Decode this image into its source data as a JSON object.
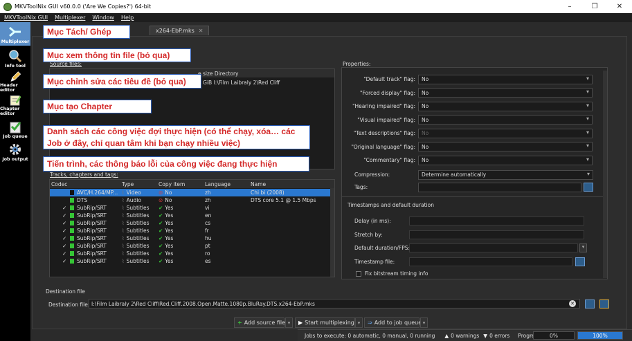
{
  "window": {
    "title": "MKVToolNix GUI v60.0.0 ('Are We Copies?') 64-bit",
    "minimize": "–",
    "maximize": "❐",
    "close": "✕"
  },
  "menu": [
    "MKVToolNix GUI",
    "Multiplexer",
    "Window",
    "Help"
  ],
  "tools": [
    {
      "label": "Multiplexer",
      "icon": "multiplexer-icon"
    },
    {
      "label": "Info tool",
      "icon": "magnifier-icon"
    },
    {
      "label": "Header editor",
      "icon": "pencil-icon"
    },
    {
      "label": "Chapter editor",
      "icon": "notepad-icon"
    },
    {
      "label": "Job queue",
      "icon": "checklist-icon"
    },
    {
      "label": "Job output",
      "icon": "gear-icon"
    }
  ],
  "tab": {
    "label": "x264-EbP.mks",
    "close": "✕"
  },
  "source_files": {
    "label": "Source files:",
    "header_tail": "e size Directory",
    "row_tail": "7 GiB  I:\\Film Laibraly 2\\Red Cliff"
  },
  "tracks": {
    "label": "Tracks, chapters and tags:",
    "columns": [
      "Codec",
      "Type",
      "Copy item",
      "Language",
      "Name"
    ],
    "rows": [
      {
        "check": "",
        "codec": "AVC/H.264/MP...",
        "type": "Video",
        "copy": "No",
        "copy_yes": false,
        "lang": "zh",
        "name": "Chi bi (2008)",
        "selected": true
      },
      {
        "check": "",
        "codec": "DTS",
        "type": "Audio",
        "copy": "No",
        "copy_yes": false,
        "lang": "zh",
        "name": "DTS core 5.1 @ 1.5 Mbps",
        "selected": false
      },
      {
        "check": "✓",
        "codec": "SubRip/SRT",
        "type": "Subtitles",
        "copy": "Yes",
        "copy_yes": true,
        "lang": "vi",
        "name": "",
        "selected": false
      },
      {
        "check": "✓",
        "codec": "SubRip/SRT",
        "type": "Subtitles",
        "copy": "Yes",
        "copy_yes": true,
        "lang": "en",
        "name": "",
        "selected": false
      },
      {
        "check": "✓",
        "codec": "SubRip/SRT",
        "type": "Subtitles",
        "copy": "Yes",
        "copy_yes": true,
        "lang": "cs",
        "name": "",
        "selected": false
      },
      {
        "check": "✓",
        "codec": "SubRip/SRT",
        "type": "Subtitles",
        "copy": "Yes",
        "copy_yes": true,
        "lang": "fr",
        "name": "",
        "selected": false
      },
      {
        "check": "✓",
        "codec": "SubRip/SRT",
        "type": "Subtitles",
        "copy": "Yes",
        "copy_yes": true,
        "lang": "hu",
        "name": "",
        "selected": false
      },
      {
        "check": "✓",
        "codec": "SubRip/SRT",
        "type": "Subtitles",
        "copy": "Yes",
        "copy_yes": true,
        "lang": "pt",
        "name": "",
        "selected": false
      },
      {
        "check": "✓",
        "codec": "SubRip/SRT",
        "type": "Subtitles",
        "copy": "Yes",
        "copy_yes": true,
        "lang": "ro",
        "name": "",
        "selected": false
      },
      {
        "check": "✓",
        "codec": "SubRip/SRT",
        "type": "Subtitles",
        "copy": "Yes",
        "copy_yes": true,
        "lang": "es",
        "name": "",
        "selected": false
      }
    ]
  },
  "properties": {
    "label": "Properties:",
    "flags": [
      {
        "label": "\"Default track\" flag:",
        "value": "No",
        "disabled": false
      },
      {
        "label": "\"Forced display\" flag:",
        "value": "No",
        "disabled": false
      },
      {
        "label": "\"Hearing impaired\" flag:",
        "value": "No",
        "disabled": false
      },
      {
        "label": "\"Visual impaired\" flag:",
        "value": "No",
        "disabled": false
      },
      {
        "label": "\"Text descriptions\" flag:",
        "value": "No",
        "disabled": true
      },
      {
        "label": "\"Original language\" flag:",
        "value": "No",
        "disabled": false
      },
      {
        "label": "\"Commentary\" flag:",
        "value": "No",
        "disabled": false
      }
    ],
    "compression_label": "Compression:",
    "compression_value": "Determine automatically",
    "tags_label": "Tags:",
    "timestamps_label": "Timestamps and default duration",
    "delay_label": "Delay (in ms):",
    "stretch_label": "Stretch by:",
    "default_duration_label": "Default duration/FPS:",
    "timestamp_file_label": "Timestamp file:",
    "fix_bitstream_label": "Fix bitstream timing info"
  },
  "destination": {
    "group_label": "Destination file",
    "label": "Destination file:",
    "value": "I:\\Film Laibraly 2\\Red Cliff\\Red.Cliff.2008.Open.Matte.1080p.BluRay.DTS.x264-EbP.mks"
  },
  "actions": {
    "add_source": "Add source files",
    "start": "Start multiplexing",
    "add_queue": "Add to job queue"
  },
  "status": {
    "jobs": "Jobs to execute:  0 automatic, 0 manual, 0 running",
    "warnings": "0 warnings",
    "errors": "0 errors",
    "progress_label": "Progress:",
    "progress_current": "0%",
    "progress_total": "100%"
  },
  "annotations": [
    "Mục Tách/ Ghép",
    "Mục xem thông tin file (bỏ qua)",
    "Mục chỉnh sửa các tiêu đề (bỏ qua)",
    "Mục tạo Chapter",
    "Danh sách các công việc đợi thực hiện (có thể chạy, xóa… các",
    "Job ở đây, chỉ quan tâm khi bạn chạy nhiều việc)",
    "Tiến trình, các thông báo lỗi của công việc đang thực hiện"
  ],
  "colors": {
    "selection": "#2a78d0",
    "annotation_text": "#d42a2a",
    "annotation_border": "#2b5db8",
    "check_green": "#35c435",
    "no_red": "#d93a3a"
  }
}
